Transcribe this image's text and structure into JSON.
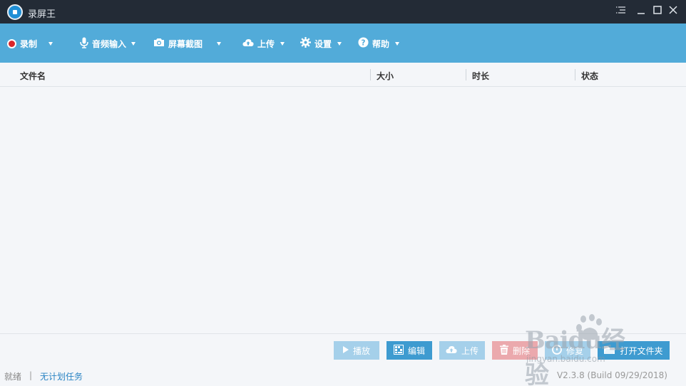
{
  "window": {
    "title": "录屏王"
  },
  "titlebar": {
    "menu_icon": "list-menu-icon",
    "minimize_icon": "minimize-icon",
    "maximize_icon": "maximize-icon",
    "close_icon": "close-icon"
  },
  "toolbar": {
    "items": [
      {
        "label": "录制",
        "icon": "record-icon",
        "has_dropdown": true
      },
      {
        "label": "音频输入",
        "icon": "microphone-icon",
        "has_dropdown": true
      },
      {
        "label": "屏幕截图",
        "icon": "camera-icon",
        "has_dropdown": true
      },
      {
        "label": "上传",
        "icon": "cloud-upload-icon",
        "has_dropdown": true
      },
      {
        "label": "设置",
        "icon": "gear-icon",
        "has_dropdown": true
      },
      {
        "label": "帮助",
        "icon": "help-icon",
        "has_dropdown": true
      }
    ],
    "color": "#52abd9"
  },
  "table": {
    "columns": [
      "文件名",
      "大小",
      "时长",
      "状态"
    ],
    "rows": []
  },
  "actions": {
    "play": "播放",
    "edit": "编辑",
    "upload": "上传",
    "delete": "删除",
    "fix": "修复",
    "open_folder": "打开文件夹"
  },
  "status": {
    "ready": "就绪",
    "separator": "|",
    "task": "无计划任务",
    "version": "V2.3.8 (Build 09/29/2018)"
  },
  "watermark": {
    "text": "Baidu经验",
    "url": "jingyan.baidu.com"
  }
}
